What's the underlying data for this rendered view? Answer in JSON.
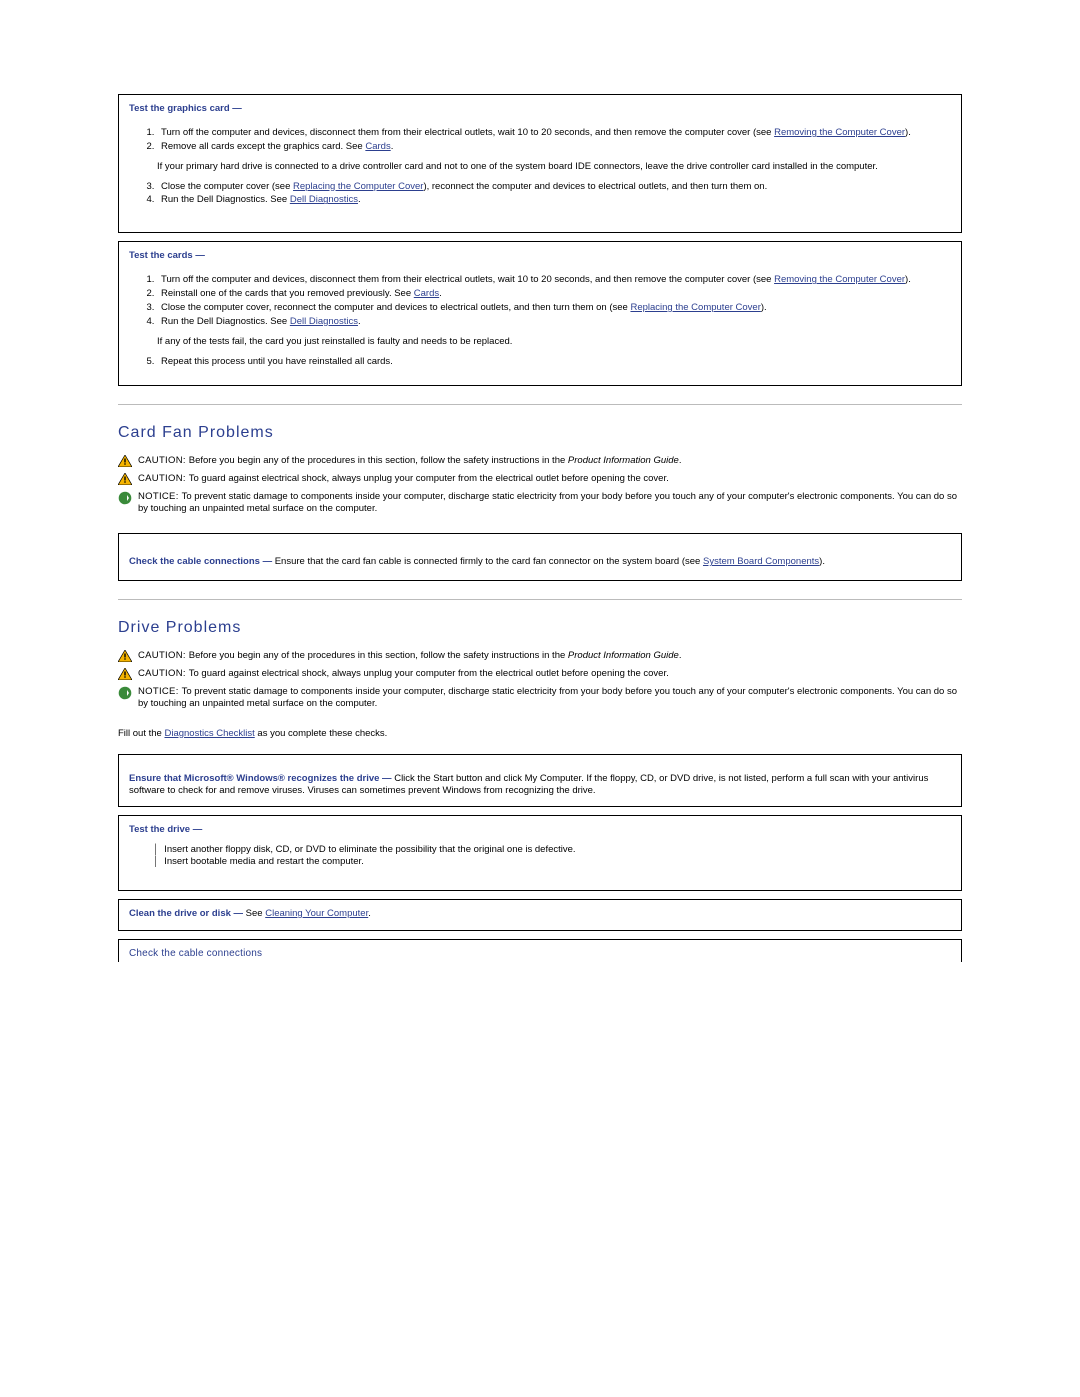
{
  "box1": {
    "heading": "Test the graphics card  —",
    "li1a": "Turn off the computer and devices, disconnect them from their electrical outlets, wait 10 to 20 seconds, and then remove the computer cover (see ",
    "li1link": "Removing the Computer Cover",
    "li1b": ").",
    "li2a": "Remove all cards except the graphics card. See ",
    "li2link": "Cards",
    "li2b": ".",
    "note": "If your primary hard drive is connected to a drive controller card and not to one of the system board IDE connectors, leave the drive controller card installed in the computer.",
    "li3a": "Close the computer cover (see ",
    "li3link": "Replacing the Computer Cover",
    "li3b": "), reconnect the computer and devices to electrical outlets, and then turn them on.",
    "li4a": "Run the Dell Diagnostics. See ",
    "li4link": "Dell Diagnostics",
    "li4b": "."
  },
  "box2": {
    "heading": "Test the cards  —",
    "li1a": "Turn off the computer and devices, disconnect them from their electrical outlets, wait 10 to 20 seconds, and then remove the computer cover (see ",
    "li1link": "Removing the Computer Cover",
    "li1b": ").",
    "li2a": "Reinstall one of the cards that you removed previously. See ",
    "li2link": "Cards",
    "li2b": ".",
    "li3a": "Close the computer cover, reconnect the computer and devices to electrical outlets, and then turn them on (see ",
    "li3link": "Replacing the Computer Cover",
    "li3b": ").",
    "li4a": "Run the Dell Diagnostics. See ",
    "li4link": "Dell Diagnostics",
    "li4b": ".",
    "note1": "If any of the tests fail, the card you just reinstalled is faulty and needs to be replaced.",
    "li5": "Repeat this process until you have reinstalled all cards."
  },
  "sectionA": {
    "title": "Card Fan Problems",
    "caution1a": "CAUTION: ",
    "caution1b": "Before you begin any of the procedures in this section, follow the safety instructions in the ",
    "caution1c": "Product Information Guide",
    "caution1d": ".",
    "caution2a": "CAUTION: ",
    "caution2b": "To guard against electrical shock, always unplug your computer from the electrical outlet before opening the cover.",
    "notice1a": "NOTICE: ",
    "notice1b": "To prevent static damage to components inside your computer, discharge static electricity from your body before you touch any of your computer's electronic components. You can do so by touching an unpainted metal surface on the computer."
  },
  "box3": {
    "boldlead": "Check the cable connections — ",
    "text": "Ensure that the card fan cable is connected firmly to the card fan connector on the system board (see ",
    "link": "System Board Components",
    "tail": ")."
  },
  "sectionB": {
    "title": "Drive Problems",
    "caution1a": "CAUTION: ",
    "caution1b": "Before you begin any of the procedures in this section, follow the safety instructions in the ",
    "caution1c": "Product Information Guide",
    "caution1d": ".",
    "caution2a": "CAUTION: ",
    "caution2b": "To guard against electrical shock, always unplug your computer from the electrical outlet before opening the cover.",
    "notice1a": "NOTICE: ",
    "notice1b": "To prevent static damage to components inside your computer, discharge static electricity from your body before you touch any of your computer's electronic components. You can do so by touching an unpainted metal surface on the computer.",
    "fill1": "Fill out the ",
    "filllink": "Diagnostics Checklist",
    "fill2": " as you complete these checks."
  },
  "box4": {
    "lead1": "Ensure that Microsoft",
    "reg": "®",
    "lead2": " Windows",
    "lead3": " recognizes the drive — ",
    "rest": "Click the Start button and click My Computer. If the floppy, CD, or DVD drive, is not listed, perform a full scan with your antivirus software to check for and remove viruses. Viruses can sometimes prevent Windows from recognizing the drive."
  },
  "box5": {
    "heading": "Test the drive  —",
    "b1": "Insert another floppy disk, CD, or DVD to eliminate the possibility that the original one is defective.",
    "b2": "Insert bootable media and restart the computer."
  },
  "box6": {
    "lead": "Clean the drive or disk — ",
    "pre": "See ",
    "link": "Cleaning Your Computer",
    "post": "."
  },
  "box7": {
    "text": "Check the cable connections"
  }
}
